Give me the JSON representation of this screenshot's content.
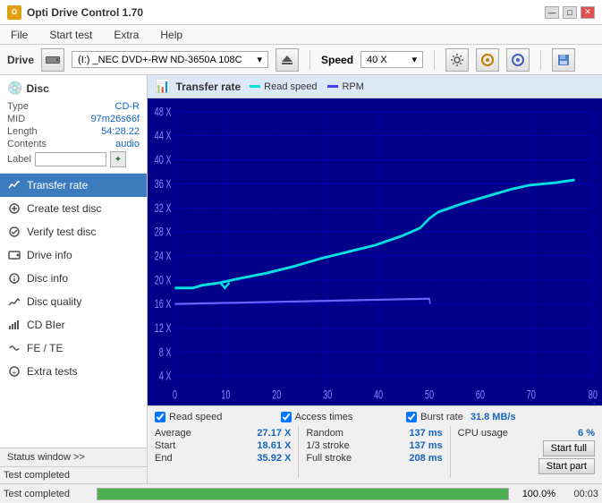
{
  "titlebar": {
    "title": "Opti Drive Control 1.70",
    "icon_label": "O",
    "btn_min": "—",
    "btn_max": "□",
    "btn_close": "✕"
  },
  "menubar": {
    "items": [
      {
        "label": "File"
      },
      {
        "label": "Start test"
      },
      {
        "label": "Extra"
      },
      {
        "label": "Help"
      }
    ]
  },
  "toolbar": {
    "drive_label": "Drive",
    "drive_value": "(I:) _NEC DVD+-RW ND-3650A 108C",
    "speed_label": "Speed",
    "speed_value": "40 X"
  },
  "disc": {
    "title": "Disc",
    "type_key": "Type",
    "type_val": "CD-R",
    "mid_key": "MID",
    "mid_val": "97m26s66f",
    "length_key": "Length",
    "length_val": "54:28.22",
    "contents_key": "Contents",
    "contents_val": "audio",
    "label_key": "Label",
    "label_val": ""
  },
  "nav": {
    "items": [
      {
        "id": "transfer-rate",
        "label": "Transfer rate",
        "active": true
      },
      {
        "id": "create-test-disc",
        "label": "Create test disc",
        "active": false
      },
      {
        "id": "verify-test-disc",
        "label": "Verify test disc",
        "active": false
      },
      {
        "id": "drive-info",
        "label": "Drive info",
        "active": false
      },
      {
        "id": "disc-info",
        "label": "Disc info",
        "active": false
      },
      {
        "id": "disc-quality",
        "label": "Disc quality",
        "active": false
      },
      {
        "id": "cd-bler",
        "label": "CD BIer",
        "active": false
      },
      {
        "id": "fe-te",
        "label": "FE / TE",
        "active": false
      },
      {
        "id": "extra-tests",
        "label": "Extra tests",
        "active": false
      }
    ]
  },
  "status": {
    "window_btn": "Status window >>",
    "test_completed": "Test completed",
    "progress_pct": "100.0%",
    "time": "00:03"
  },
  "chart": {
    "title": "Transfer rate",
    "legend_read": "Read speed",
    "legend_rpm": "RPM",
    "y_labels": [
      "48 X",
      "44 X",
      "40 X",
      "36 X",
      "32 X",
      "28 X",
      "24 X",
      "20 X",
      "16 X",
      "12 X",
      "8 X",
      "4 X"
    ],
    "x_labels": [
      "0",
      "10",
      "20",
      "30",
      "40",
      "50",
      "60",
      "70",
      "80"
    ],
    "x_unit": "min"
  },
  "stats": {
    "read_speed_checked": true,
    "read_speed_label": "Read speed",
    "access_times_checked": true,
    "access_times_label": "Access times",
    "burst_rate_checked": true,
    "burst_rate_label": "Burst rate",
    "burst_rate_val": "31.8 MB/s",
    "average_key": "Average",
    "average_val": "27.17 X",
    "random_key": "Random",
    "random_val": "137 ms",
    "cpu_key": "CPU usage",
    "cpu_val": "6 %",
    "start_key": "Start",
    "start_val": "18.61 X",
    "one_third_key": "1/3 stroke",
    "one_third_val": "137 ms",
    "start_full_label": "Start full",
    "end_key": "End",
    "end_val": "35.92 X",
    "full_stroke_key": "Full stroke",
    "full_stroke_val": "208 ms",
    "start_part_label": "Start part"
  }
}
